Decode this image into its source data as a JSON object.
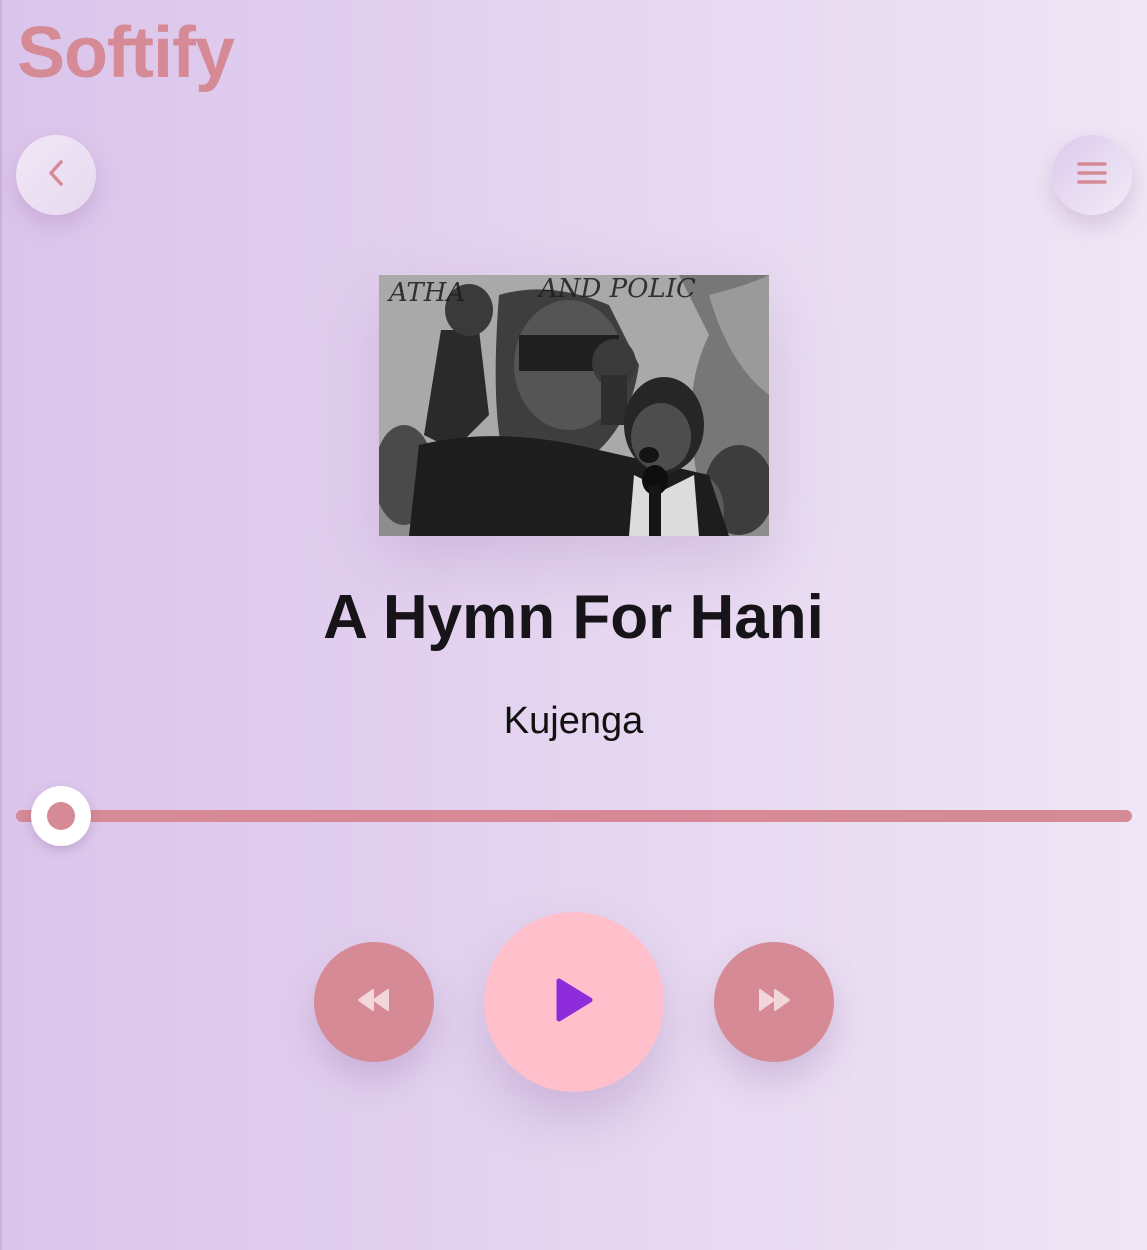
{
  "app": {
    "title": "Softify"
  },
  "header": {
    "back_icon": "chevron-left-icon",
    "menu_icon": "hamburger-menu-icon"
  },
  "track": {
    "title": "A Hymn For Hani",
    "artist": "Kujenga",
    "cover_art": "black-and-white photo of a man with raised fist speaking into a microphone",
    "progress": 0.04
  },
  "controls": {
    "rewind_icon": "rewind-icon",
    "play_icon": "play-icon",
    "forward_icon": "fast-forward-icon"
  },
  "colors": {
    "accent": "#d58a95",
    "play_button": "#ffc0cb",
    "play_icon": "#8e2bdb",
    "control_icon": "#f3d6db",
    "background_start": "#dbc4eb",
    "background_end": "#efe6f5"
  }
}
